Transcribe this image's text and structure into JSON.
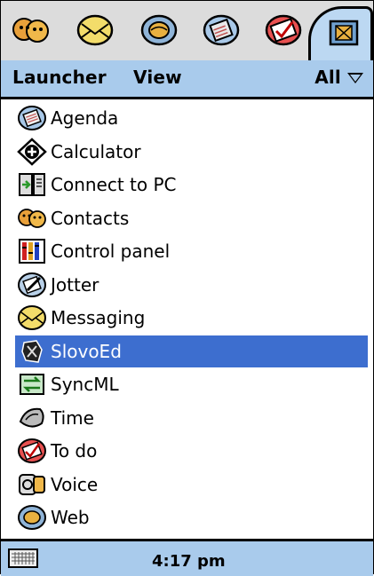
{
  "toolbar": {
    "icons": [
      "contacts-icon",
      "messaging-icon",
      "web-icon",
      "agenda-icon",
      "todo-icon",
      "launcher-icon"
    ]
  },
  "menubar": {
    "launcher": "Launcher",
    "view": "View",
    "filter": "All"
  },
  "apps": [
    {
      "label": "Agenda",
      "icon": "agenda-icon"
    },
    {
      "label": "Calculator",
      "icon": "calculator-icon"
    },
    {
      "label": "Connect to PC",
      "icon": "connect-pc-icon"
    },
    {
      "label": "Contacts",
      "icon": "contacts-icon"
    },
    {
      "label": "Control panel",
      "icon": "control-panel-icon"
    },
    {
      "label": "Jotter",
      "icon": "jotter-icon"
    },
    {
      "label": "Messaging",
      "icon": "messaging-icon"
    },
    {
      "label": "SlovoEd",
      "icon": "slovoed-icon",
      "selected": true
    },
    {
      "label": "SyncML",
      "icon": "syncml-icon"
    },
    {
      "label": "Time",
      "icon": "time-icon"
    },
    {
      "label": "To do",
      "icon": "todo-icon"
    },
    {
      "label": "Voice",
      "icon": "voice-icon"
    },
    {
      "label": "Web",
      "icon": "web-icon"
    }
  ],
  "status": {
    "time": "4:17 pm"
  },
  "colors": {
    "menubar": "#a9cbec",
    "selection": "#3d6ecf",
    "toolbar": "#dcdcdc"
  }
}
